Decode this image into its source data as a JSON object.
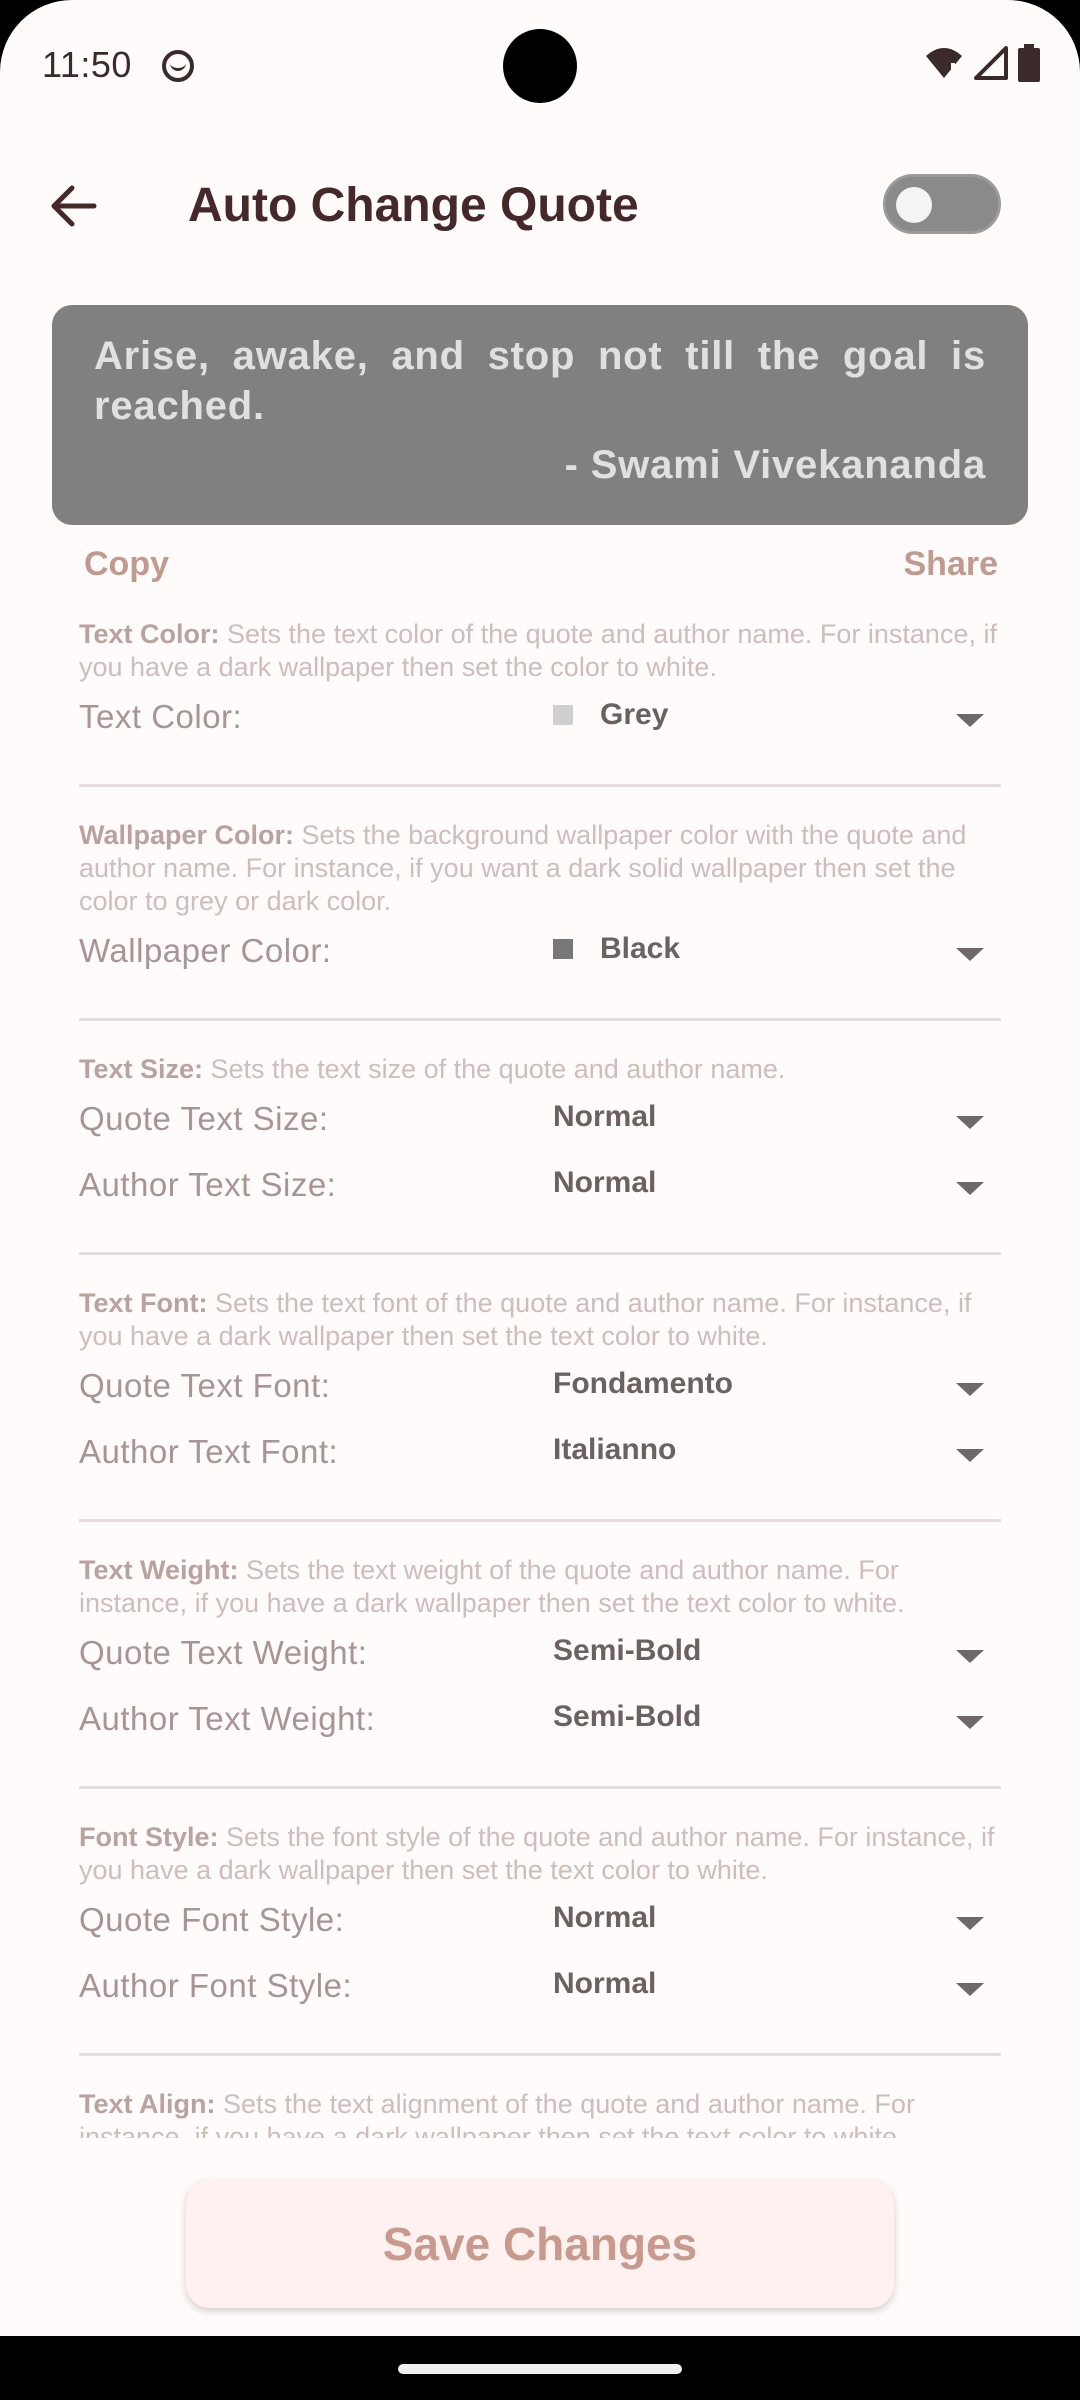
{
  "status_bar": {
    "time": "11:50"
  },
  "header": {
    "title": "Auto Change Quote",
    "toggle_state": "off"
  },
  "quote": {
    "text": "Arise, awake, and stop not till the goal is reached.",
    "author": "-  Swami Vivekananda"
  },
  "actions": {
    "copy": "Copy",
    "share": "Share"
  },
  "sections": {
    "text_color": {
      "title": "Text Color:",
      "desc": " Sets the text color of the quote and author name. For instance, if you have a dark wallpaper then set the color to white.",
      "rows": [
        {
          "label": "Text Color:",
          "value": "Grey",
          "swatch": "#cfcfcf"
        }
      ]
    },
    "wallpaper_color": {
      "title": "Wallpaper Color:",
      "desc": " Sets the background wallpaper color with the quote and author name. For instance, if you want a dark solid wallpaper then set the color to grey or dark color.",
      "rows": [
        {
          "label": "Wallpaper Color:",
          "value": "Black",
          "swatch": "#777777"
        }
      ]
    },
    "text_size": {
      "title": "Text Size:",
      "desc": " Sets the text size of the quote and author name.",
      "rows": [
        {
          "label": "Quote Text Size:",
          "value": "Normal"
        },
        {
          "label": "Author Text Size:",
          "value": "Normal"
        }
      ]
    },
    "text_font": {
      "title": "Text Font:",
      "desc": " Sets the text font of the quote and author name. For instance, if you have a dark wallpaper then set the text color to white.",
      "rows": [
        {
          "label": "Quote Text Font:",
          "value": "Fondamento"
        },
        {
          "label": "Author Text Font:",
          "value": "Italianno"
        }
      ]
    },
    "text_weight": {
      "title": "Text Weight:",
      "desc": " Sets the text weight of the quote and author name. For instance, if you have a dark wallpaper then set the text color to white.",
      "rows": [
        {
          "label": "Quote Text Weight:",
          "value": "Semi-Bold"
        },
        {
          "label": "Author Text Weight:",
          "value": "Semi-Bold"
        }
      ]
    },
    "font_style": {
      "title": "Font Style:",
      "desc": " Sets the font style of the quote and author name. For instance, if you have a dark wallpaper then set the text color to white.",
      "rows": [
        {
          "label": "Quote Font Style:",
          "value": "Normal"
        },
        {
          "label": "Author Font Style:",
          "value": "Normal"
        }
      ]
    },
    "text_align": {
      "title": "Text Align:",
      "desc": " Sets the text alignment of the quote and author name. For instance, if you have a dark wallpaper then set the text color to white."
    }
  },
  "save_button": "Save Changes",
  "icons": {
    "back": "arrow-left-icon",
    "status_app": "face-icon",
    "wifi": "wifi-icon",
    "signal": "signal-icon",
    "battery": "battery-icon",
    "dropdown": "caret-down-icon"
  }
}
